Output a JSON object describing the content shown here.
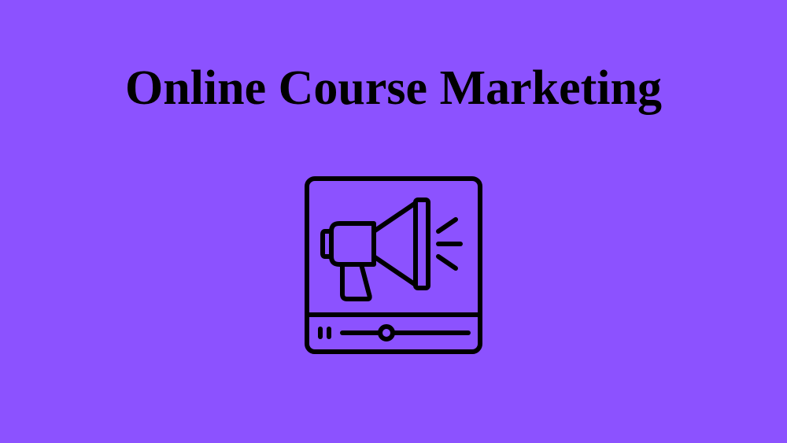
{
  "title": "Online Course Marketing",
  "icon": "megaphone-video-player-icon",
  "colors": {
    "background": "#8c52ff",
    "foreground": "#000000"
  }
}
